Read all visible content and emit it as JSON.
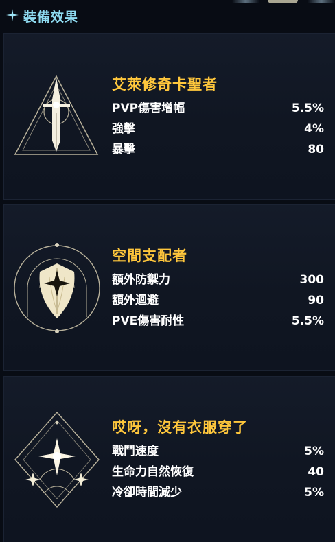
{
  "header": {
    "title": "裝備效果",
    "icon": "sparkle-icon"
  },
  "sets": [
    {
      "title": "艾萊修奇卡聖者",
      "emblem": "sword-triangle-emblem-icon",
      "stats": [
        {
          "label": "PVP傷害增幅",
          "value": "5.5%"
        },
        {
          "label": "強擊",
          "value": "4%"
        },
        {
          "label": "暴擊",
          "value": "80"
        }
      ]
    },
    {
      "title": "空間支配者",
      "emblem": "shield-circle-emblem-icon",
      "stats": [
        {
          "label": "額外防禦力",
          "value": "300"
        },
        {
          "label": "額外迴避",
          "value": "90"
        },
        {
          "label": "PVE傷害耐性",
          "value": "5.5%"
        }
      ]
    },
    {
      "title": "哎呀，沒有衣服穿了",
      "emblem": "star-diamond-emblem-icon",
      "stats": [
        {
          "label": "戰鬥速度",
          "value": "5%"
        },
        {
          "label": "生命力自然恢復",
          "value": "40"
        },
        {
          "label": "冷卻時間減少",
          "value": "5%"
        }
      ]
    }
  ],
  "colors": {
    "title": "#ffc73c",
    "header": "#8fdcf2",
    "background": "#080c14"
  }
}
